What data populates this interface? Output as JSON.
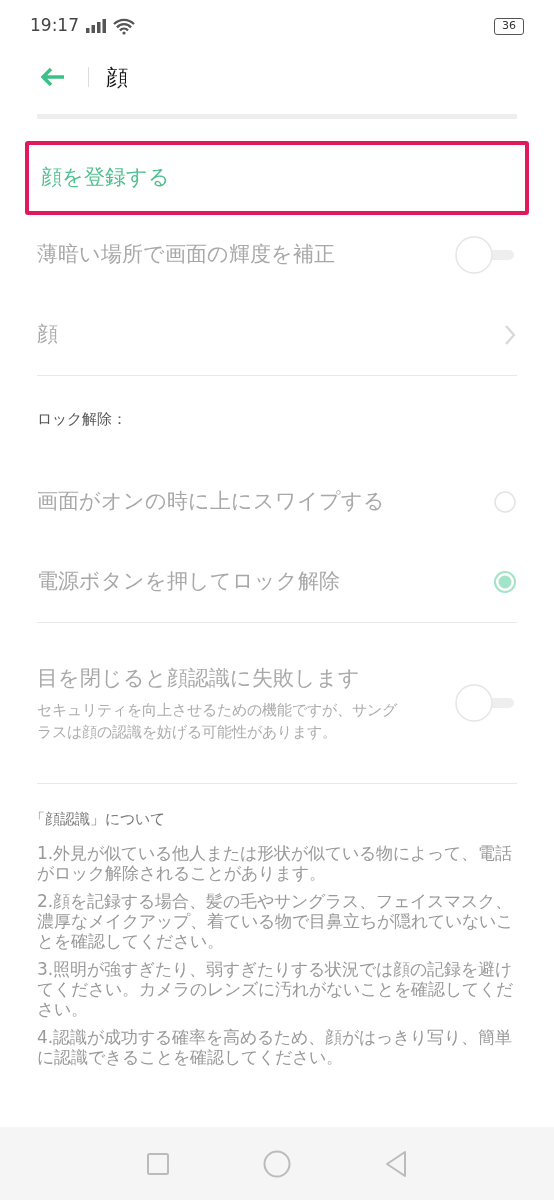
{
  "status_bar": {
    "time": "19:17",
    "battery": "36"
  },
  "header": {
    "title": "顔"
  },
  "register": {
    "label": "顔を登録する",
    "highlighted": true
  },
  "settings": [
    {
      "kind": "toggle",
      "label": "薄暗い場所で画面の輝度を補正",
      "on": false,
      "disabled": true
    },
    {
      "kind": "link",
      "label": "顔",
      "disabled": true
    },
    {
      "kind": "divider"
    },
    {
      "kind": "section",
      "label": "ロック解除："
    },
    {
      "kind": "radio",
      "label": "画面がオンの時に上にスワイプする",
      "selected": false,
      "disabled": true
    },
    {
      "kind": "radio",
      "label": "電源ボタンを押してロック解除",
      "selected": true,
      "disabled": true
    },
    {
      "kind": "divider"
    },
    {
      "kind": "toggle",
      "label": "目を閉じると顔認識に失敗します",
      "description": "セキュリティを向上させるための機能ですが、サングラスは顔の認識を妨げる可能性があります。",
      "on": false,
      "disabled": true
    },
    {
      "kind": "divider"
    }
  ],
  "about": {
    "title": "「顔認識」について",
    "notes": [
      "1.外見が似ている他人または形状が似ている物によって、電話がロック解除されることがあります。",
      "2.顔を記録する場合、髪の毛やサングラス、フェイスマスク、濃厚なメイクアップ、着ている物で目鼻立ちが隠れていないことを確認してください。",
      "3.照明が強すぎたり、弱すぎたりする状況では顔の記録を避けてください。カメラのレンズに汚れがないことを確認してください。",
      "4.認識が成功する確率を高めるため、顔がはっきり写り、簡単に認識できることを確認してください。"
    ]
  }
}
